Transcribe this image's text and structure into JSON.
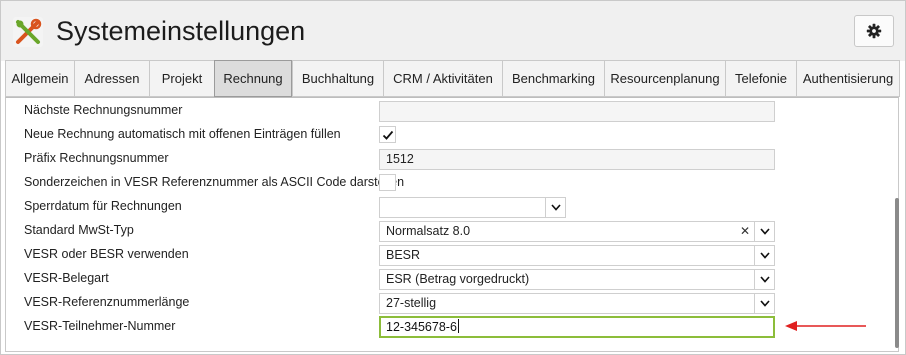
{
  "window": {
    "title": "Systemeinstellungen"
  },
  "toolbar": {
    "settings_icon": "gear-icon",
    "app_icon": "tools-icon"
  },
  "tabs": [
    {
      "label": "Allgemein",
      "active": false
    },
    {
      "label": "Adressen",
      "active": false
    },
    {
      "label": "Projekt",
      "active": false
    },
    {
      "label": "Rechnung",
      "active": true
    },
    {
      "label": "Buchhaltung",
      "active": false
    },
    {
      "label": "CRM / Aktivitäten",
      "active": false
    },
    {
      "label": "Benchmarking",
      "active": false
    },
    {
      "label": "Resourcenplanung",
      "active": false
    },
    {
      "label": "Telefonie",
      "active": false
    },
    {
      "label": "Authentisierung",
      "active": false
    }
  ],
  "settings": {
    "next_invoice_number": {
      "label": "Nächste Rechnungsnummer",
      "value": ""
    },
    "auto_fill": {
      "label": "Neue Rechnung automatisch mit offenen Einträgen füllen",
      "checked": true
    },
    "prefix": {
      "label": "Präfix Rechnungsnummer",
      "value": "1512"
    },
    "special_chars": {
      "label": "Sonderzeichen in VESR Referenznummer als ASCII Code darstellen",
      "checked": false
    },
    "lock_date": {
      "label": "Sperrdatum für Rechnungen",
      "value": ""
    },
    "vat_type": {
      "label": "Standard MwSt-Typ",
      "value": "Normalsatz 8.0",
      "clear": "✕"
    },
    "vesr_besr": {
      "label": "VESR oder BESR verwenden",
      "value": "BESR"
    },
    "vesr_type": {
      "label": "VESR-Belegart",
      "value": "ESR (Betrag vorgedruckt)"
    },
    "vesr_ref_length": {
      "label": "VESR-Referenznummerlänge",
      "value": "27-stellig"
    },
    "vesr_participant": {
      "label": "VESR-Teilnehmer-Nummer",
      "value": "12-345678-6"
    }
  },
  "colors": {
    "focus_border": "#8cbd3a",
    "annotation_arrow": "#e02020",
    "active_tab": "#dcdcdc"
  }
}
